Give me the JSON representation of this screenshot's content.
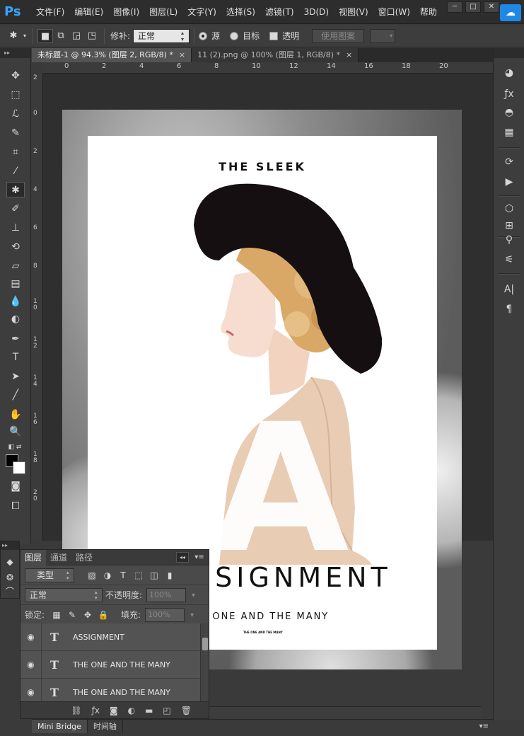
{
  "app": {
    "logo": "Ps",
    "menu": [
      "文件(F)",
      "编辑(E)",
      "图像(I)",
      "图层(L)",
      "文字(Y)",
      "选择(S)",
      "滤镜(T)",
      "3D(D)",
      "视图(V)",
      "窗口(W)",
      "帮助"
    ],
    "window_controls": [
      "─",
      "□",
      "✕"
    ]
  },
  "options_bar": {
    "patch_label": "修补:",
    "patch_mode": "正常",
    "source_label": "源",
    "target_label": "目标",
    "transparent_label": "透明",
    "use_pattern_label": "使用图案"
  },
  "tabs": [
    {
      "label": "未标题-1 @ 94.3% (图层 2, RGB/8) *",
      "close": "×"
    },
    {
      "label": "11 (2).png @ 100% (图层 1, RGB/8) *",
      "close": "×"
    }
  ],
  "rulers": {
    "top": [
      "0",
      "2",
      "4",
      "6",
      "8",
      "10",
      "12",
      "14",
      "16",
      "18",
      "20"
    ],
    "left": [
      "2",
      "0",
      "2",
      "4",
      "6",
      "8",
      "10",
      "12",
      "14",
      "16",
      "18",
      "20"
    ]
  },
  "poster": {
    "title": "THE SLEEK",
    "big_letter": "A",
    "word": "SSIGNMENT",
    "subtitle": "E ONE AND THE MANY",
    "small_text": "THE ONE AND THE MANY"
  },
  "layers_panel": {
    "tabs": [
      "图层",
      "通道",
      "路径"
    ],
    "filter_type": "类型",
    "blend_mode": "正常",
    "opacity_label": "不透明度:",
    "opacity_value": "100%",
    "lock_label": "锁定:",
    "fill_label": "填充:",
    "fill_value": "100%",
    "layers": [
      {
        "name": "ASSIGNMENT",
        "type_glyph": "T"
      },
      {
        "name": "THE ONE AND THE MANY",
        "type_glyph": "T"
      },
      {
        "name": "THE ONE AND THE MANY",
        "type_glyph": "T"
      }
    ]
  },
  "bottom_tabs": [
    "Mini Bridge",
    "时间轴"
  ]
}
